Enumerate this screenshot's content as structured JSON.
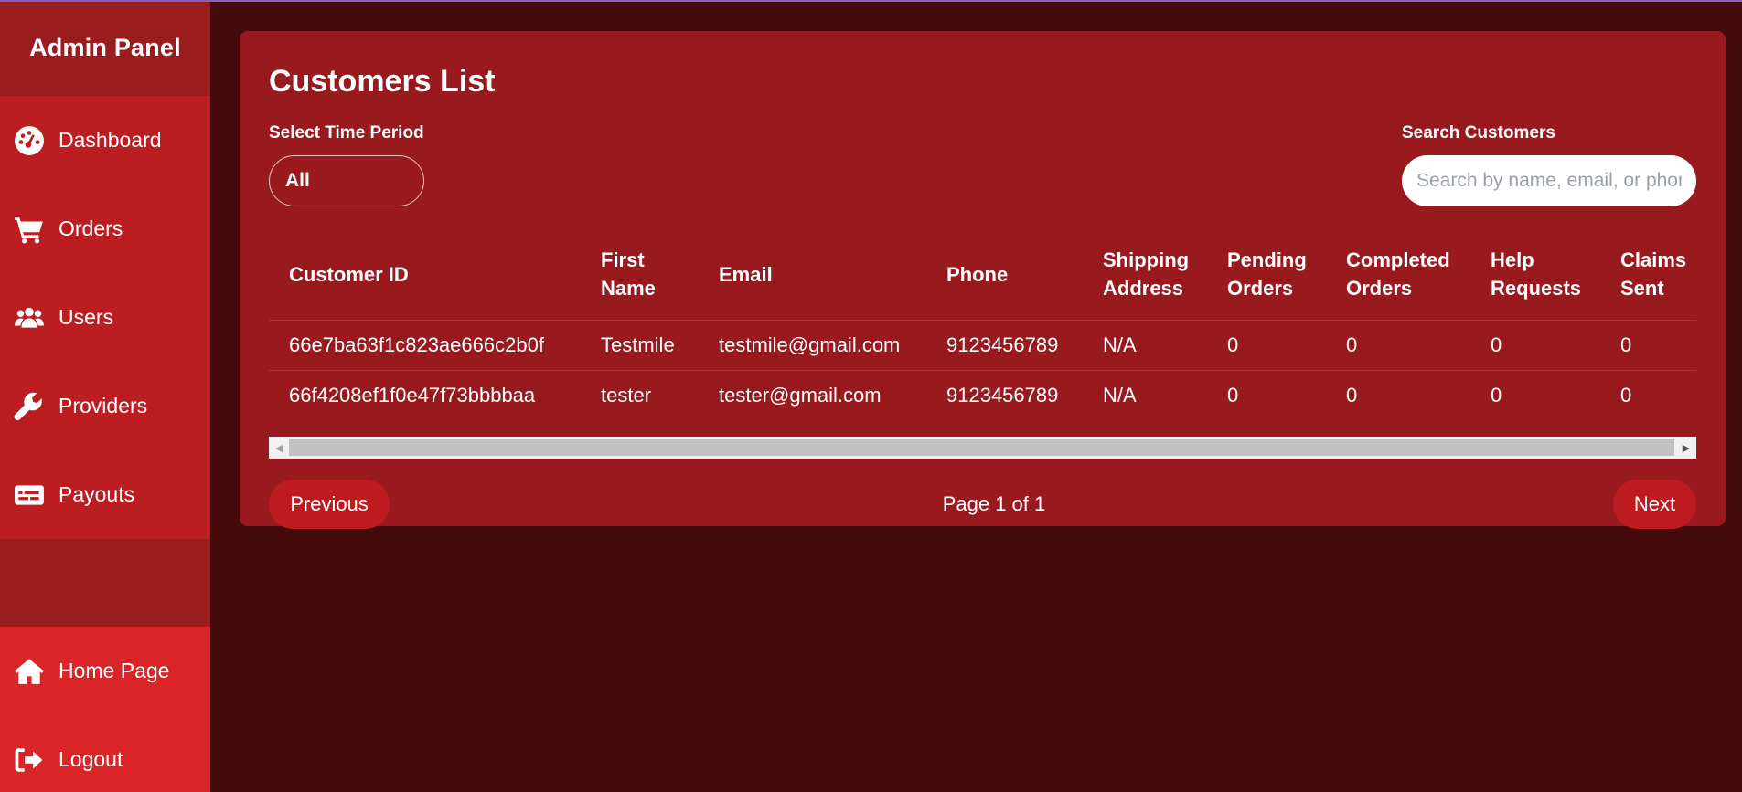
{
  "sidebar": {
    "title": "Admin Panel",
    "items": [
      {
        "label": "Dashboard",
        "icon": "dashboard-gauge-icon"
      },
      {
        "label": "Orders",
        "icon": "cart-icon"
      },
      {
        "label": "Users",
        "icon": "users-icon"
      },
      {
        "label": "Providers",
        "icon": "wrench-icon"
      },
      {
        "label": "Payouts",
        "icon": "money-check-icon"
      }
    ],
    "bottom_items": [
      {
        "label": "Home Page",
        "icon": "home-icon"
      },
      {
        "label": "Logout",
        "icon": "logout-icon"
      }
    ]
  },
  "main": {
    "title": "Customers List",
    "time_period": {
      "label": "Select Time Period",
      "value": "All"
    },
    "search": {
      "label": "Search Customers",
      "placeholder": "Search by name, email, or phone"
    },
    "table": {
      "columns": [
        "Customer ID",
        "First Name",
        "Email",
        "Phone",
        "Shipping Address",
        "Pending Orders",
        "Completed Orders",
        "Help Requests",
        "Claims Sent"
      ],
      "rows": [
        [
          "66e7ba63f1c823ae666c2b0f",
          "Testmile",
          "testmile@gmail.com",
          "9123456789",
          "N/A",
          "0",
          "0",
          "0",
          "0"
        ],
        [
          "66f4208ef1f0e47f73bbbbaa",
          "tester",
          "tester@gmail.com",
          "9123456789",
          "N/A",
          "0",
          "0",
          "0",
          "0"
        ]
      ]
    },
    "pagination": {
      "previous": "Previous",
      "page_info": "Page 1 of 1",
      "next": "Next"
    }
  },
  "colors": {
    "background": "#430b0b",
    "sidebar": "#9a1c1f",
    "sidebar_nav": "#bb1d21",
    "sidebar_bottom": "#d92527",
    "card": "#981a1f",
    "button": "#bd1b1f"
  }
}
